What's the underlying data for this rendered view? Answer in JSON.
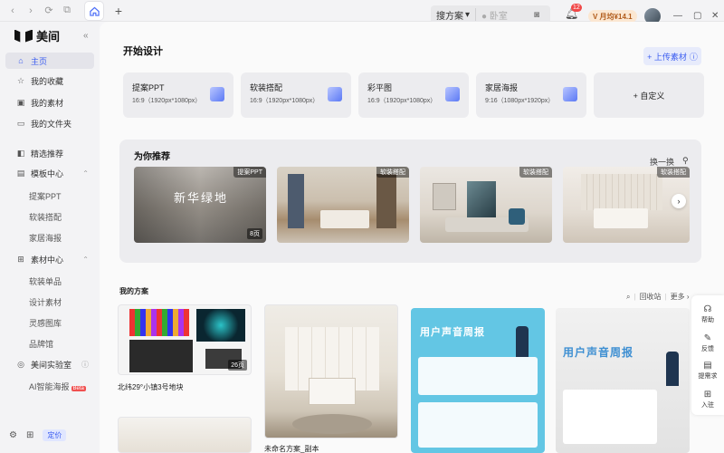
{
  "topbar": {
    "nav": [
      "‹",
      "›",
      "⟳",
      "⧉"
    ],
    "home_icon": "house-icon",
    "plus": "+",
    "search_scope": "搜方案",
    "search_placeholder": "● 卧室",
    "notification_count": "12",
    "vip_label": "V 月均¥14.1",
    "window_controls": [
      "—",
      "▢",
      "✕"
    ]
  },
  "sidebar": {
    "logo": "美间",
    "collapse": "«",
    "items": [
      {
        "label": "主页",
        "icon": "⌂",
        "active": true
      },
      {
        "label": "我的收藏",
        "icon": "☆"
      },
      {
        "label": "我的素材",
        "icon": "▣"
      },
      {
        "label": "我的文件夹",
        "icon": "▭"
      },
      {
        "label": "精选推荐",
        "icon": "◧"
      },
      {
        "label": "模板中心",
        "icon": "▤",
        "chev": "⌃"
      },
      {
        "label": "素材中心",
        "icon": "⊞",
        "chev": "⌃"
      },
      {
        "label": "美间实验室",
        "icon": "◎",
        "chev": "ⓘ"
      }
    ],
    "template_subs": [
      "提案PPT",
      "软装搭配",
      "家居海报"
    ],
    "material_subs": [
      "软装单品",
      "设计素材",
      "灵感图库",
      "品牌馆"
    ],
    "lab_sub": "AI智能海报",
    "lab_sub_badge": "Beta",
    "bottom": {
      "settings": "⚙",
      "apps": "⊞",
      "price": "定价"
    }
  },
  "main": {
    "start_title": "开始设计",
    "upload_label": "+ 上传素材",
    "upload_info": "ⓘ",
    "cards": [
      {
        "title": "提案PPT",
        "size": "16:9（1920px*1080px）"
      },
      {
        "title": "软装搭配",
        "size": "16:9（1920px*1080px）"
      },
      {
        "title": "彩平图",
        "size": "16:9（1920px*1080px）"
      },
      {
        "title": "家居海报",
        "size": "9:16（1080px*1920px）"
      }
    ],
    "custom_label": "+ 自定义",
    "recommend": {
      "title": "为你推荐",
      "swap": "换一换",
      "filter_icon": "⚲",
      "arrow": "›",
      "items": [
        {
          "tag": "提案PPT",
          "pages": "8页",
          "overlay_text": "新华绿地"
        },
        {
          "tag": "软装搭配"
        },
        {
          "tag": "软装搭配"
        },
        {
          "tag": "软装搭配"
        }
      ]
    },
    "my_plans": {
      "title": "我的方案",
      "search_icon": "⌕",
      "recycle": "回收站",
      "more": "更多 ›",
      "plans": [
        {
          "caption": "北纬29°小镇3号地块",
          "pages": "26页"
        },
        {
          "caption": "未命名方案_副本"
        },
        {
          "caption": "",
          "poster_title": "用户声音周报"
        },
        {
          "caption": "",
          "poster_title": "用户声音周报"
        }
      ]
    }
  },
  "float_panel": {
    "items": [
      {
        "icon": "☊",
        "label": "帮助"
      },
      {
        "icon": "✎",
        "label": "反馈"
      },
      {
        "icon": "▤",
        "label": "提需求"
      },
      {
        "icon": "⊞",
        "label": "入驻"
      }
    ]
  },
  "colors": {
    "accent": "#3a5cf0",
    "badge": "#f04848"
  }
}
